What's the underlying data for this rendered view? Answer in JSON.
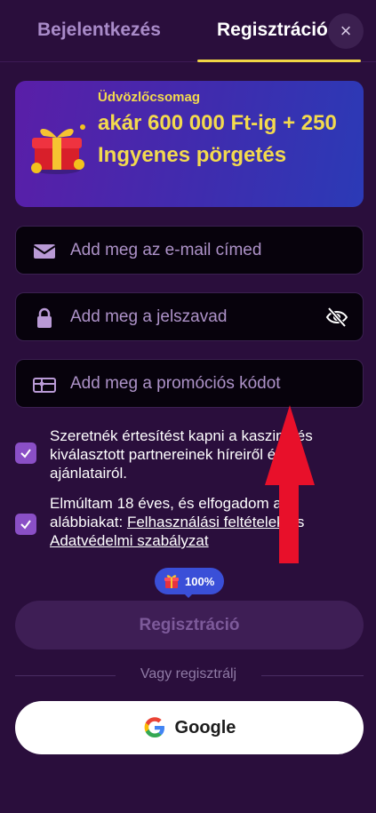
{
  "tabs": {
    "login": "Bejelentkezés",
    "register": "Regisztráció"
  },
  "close_icon": "×",
  "banner": {
    "kicker": "Üdvözlőcsomag",
    "title": "akár 600 000 Ft-ig + 250 Ingyenes pörgetés"
  },
  "fields": {
    "email_placeholder": "Add meg az e-mail címed",
    "password_placeholder": "Add meg a jelszavad",
    "promo_placeholder": "Add meg a promóciós kódot"
  },
  "consents": {
    "marketing": "Szeretnék értesítést kapni a kaszinó és kiválasztott partnereinek híreiről és ajánlatairól.",
    "terms_prefix": "Elmúltam 18 éves, és elfogadom az alábbiakat: ",
    "terms_link": "Felhasználási feltételek",
    "terms_and": " és ",
    "privacy_link": "Adatvédelmi szabályzat"
  },
  "badge": {
    "percent": "100%"
  },
  "register_button": "Regisztráció",
  "or_text": "Vagy regisztrálj",
  "google_button": "Google",
  "colors": {
    "background": "#2a0e3c",
    "accent_yellow": "#f3da4e",
    "checkbox": "#8a4fc6",
    "arrow": "#e8102a"
  }
}
